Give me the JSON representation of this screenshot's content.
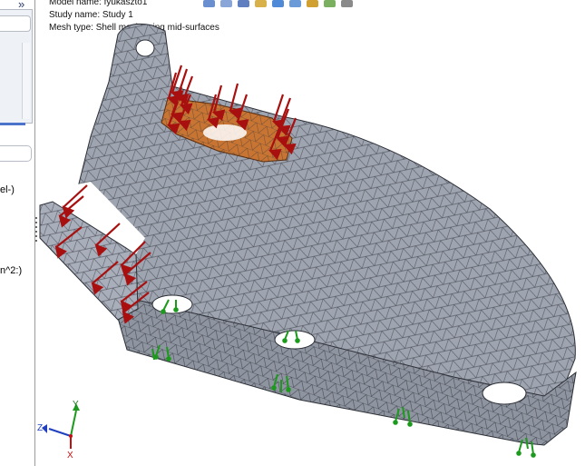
{
  "study_info": {
    "model_name": "Model name: fyukaszto1",
    "study_name": "Study name: Study 1",
    "mesh_type": "Mesh type: Shell mesh using mid-surfaces"
  },
  "left_panel": {
    "collapse_glyph": "»",
    "label_1": "el-)",
    "label_2": "n^2:)"
  },
  "triad": {
    "y": "Y",
    "z": "Z",
    "x": "X"
  },
  "colors": {
    "mesh_fill": "#9aa0ac",
    "mesh_line": "#3b3f48",
    "load_face": "#c87533",
    "force_arrow": "#a81010",
    "fixture": "#1d9a1d"
  },
  "toolbar_icons": [
    "zoom-in-icon",
    "zoom-area-icon",
    "rotate-icon",
    "view-orientation-icon",
    "display-style-icon",
    "section-view-icon",
    "appearance-icon",
    "scene-icon",
    "view-settings-icon"
  ]
}
